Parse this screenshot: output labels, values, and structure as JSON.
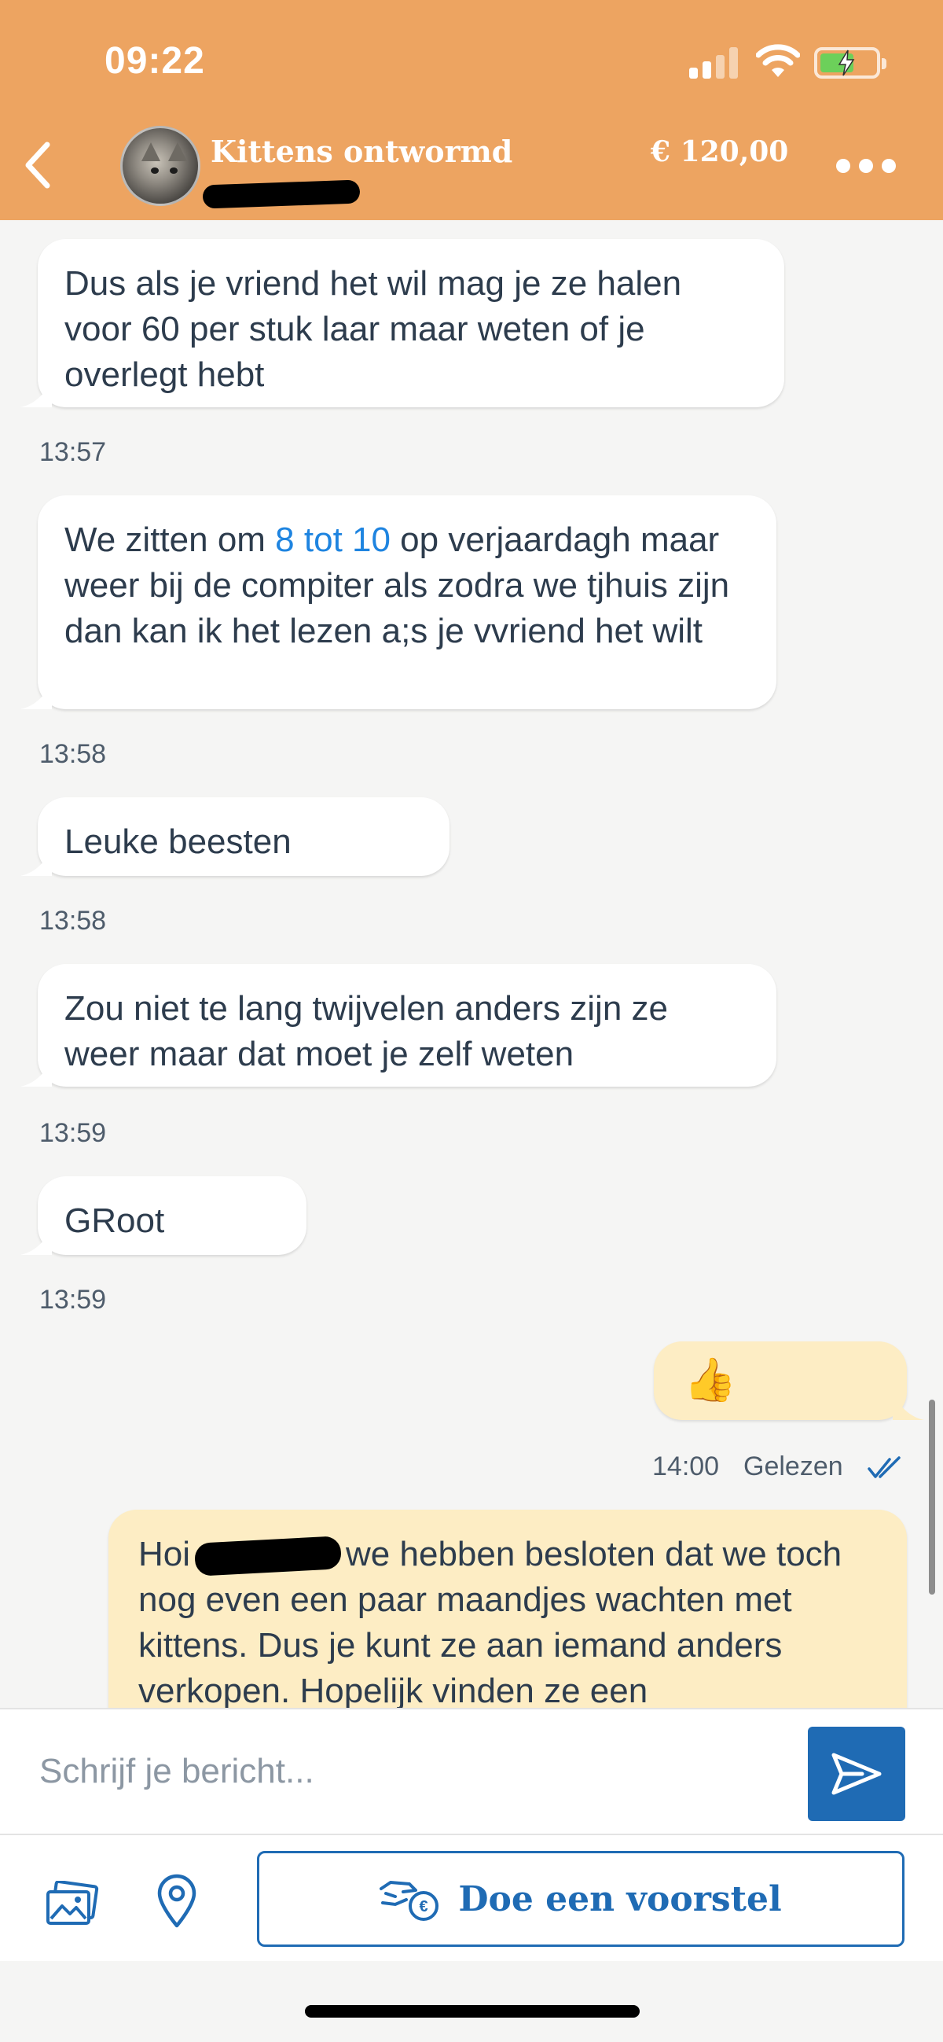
{
  "status_bar": {
    "time": "09:22"
  },
  "header": {
    "title": "Kittens ontwormd",
    "price": "€ 120,00"
  },
  "messages": [
    {
      "direction": "in",
      "text": "Dus als je vriend het wil mag je ze halen voor 60 per stuk laar maar weten of je overlegt hebt",
      "time": "13:57"
    },
    {
      "direction": "in",
      "text_before_link": "We zitten om ",
      "link": "8 tot 10",
      "text_after_link": " op verjaardagh maar weer bij de compiter als zodra we tjhuis zijn dan kan ik het lezen a;s je vvriend het wilt",
      "time": "13:58"
    },
    {
      "direction": "in",
      "text": "Leuke beesten",
      "time": "13:58"
    },
    {
      "direction": "in",
      "text": "Zou niet te lang twijvelen anders zijn ze weer maar dat moet je zelf weten",
      "time": "13:59"
    },
    {
      "direction": "in",
      "text": "GRoot",
      "time": "13:59"
    },
    {
      "direction": "out",
      "text": "👍",
      "time": "14:00",
      "status": "Gelezen"
    },
    {
      "direction": "out",
      "text_before_redaction": "Hoi",
      "text_after_redaction": "we hebben besloten dat we toch nog even een paar maandjes wachten met kittens. Dus je kunt ze aan iemand anders verkopen. Hopelijk vinden ze een"
    }
  ],
  "composer": {
    "placeholder": "Schrijf je bericht..."
  },
  "actions": {
    "offer_label": "Doe een voorstel"
  },
  "colors": {
    "header": "#eda461",
    "accent": "#1f6bb4",
    "outgoing_bubble": "#fdedc4",
    "link": "#1e84e0"
  }
}
